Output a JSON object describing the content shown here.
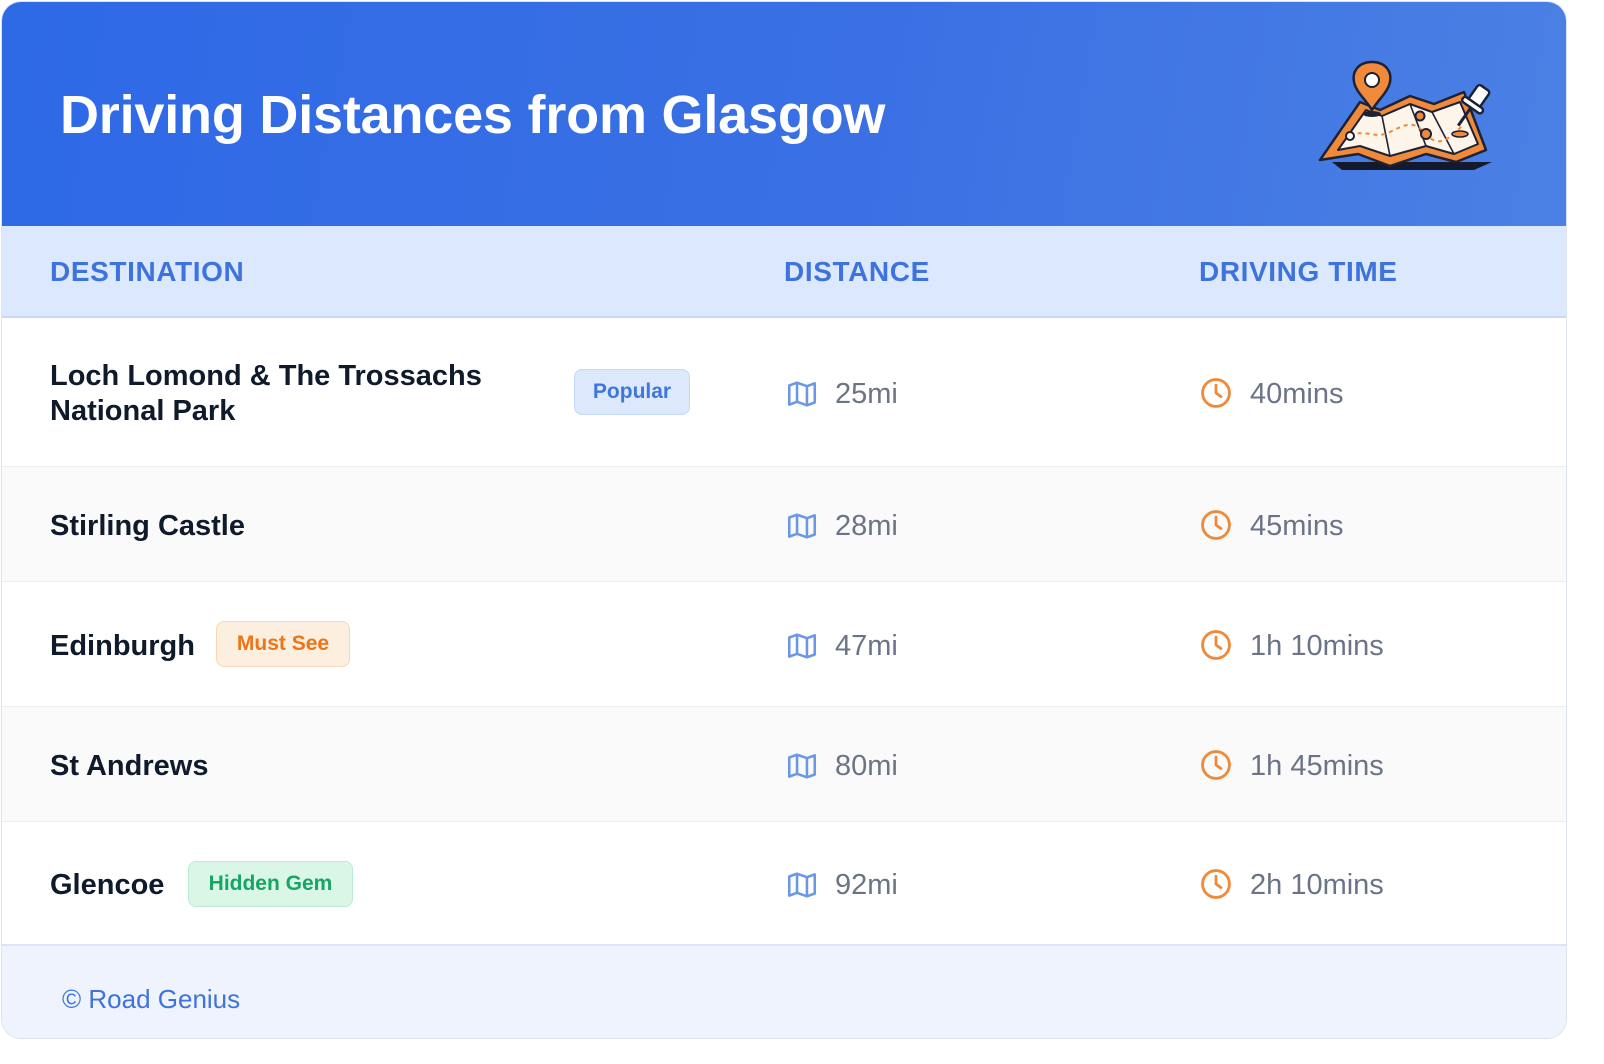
{
  "header": {
    "title": "Driving Distances from Glasgow"
  },
  "table": {
    "columns": [
      "DESTINATION",
      "DISTANCE",
      "DRIVING TIME"
    ],
    "rows": [
      {
        "destination_line1": "Loch Lomond & The Trossachs",
        "destination_line2": "National Park",
        "badge": "Popular",
        "distance": "25mi",
        "time": "40mins"
      },
      {
        "destination": "Stirling Castle",
        "distance": "28mi",
        "time": "45mins"
      },
      {
        "destination": "Edinburgh",
        "badge": "Must See",
        "distance": "47mi",
        "time": "1h 10mins"
      },
      {
        "destination": "St Andrews",
        "distance": "80mi",
        "time": "1h 45mins"
      },
      {
        "destination": "Glencoe",
        "badge": "Hidden Gem",
        "distance": "92mi",
        "time": "2h 10mins"
      }
    ]
  },
  "icons": {
    "distance": "map-icon",
    "time": "clock-icon",
    "header": "map-pin-illustration"
  },
  "colors": {
    "header_blue": "#2e69e6",
    "accent_blue": "#3e73de",
    "accent_orange": "#f08a3a",
    "badge_green": "#16a563"
  },
  "footer": {
    "text": "© Road Genius"
  }
}
